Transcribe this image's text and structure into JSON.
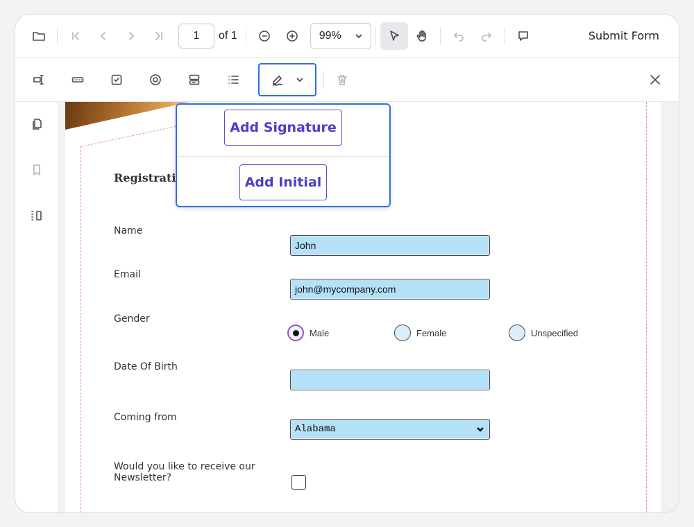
{
  "toolbar": {
    "page_number": "1",
    "page_total": "of 1",
    "zoom": "99%",
    "submit_label": "Submit Form"
  },
  "form": {
    "title": "Registration",
    "fields": {
      "name_label": "Name",
      "name_value": "John",
      "email_label": "Email",
      "email_value": "john@mycompany.com",
      "gender_label": "Gender",
      "gender_options": [
        "Male",
        "Female",
        "Unspecified"
      ],
      "dob_label": "Date Of Birth",
      "coming_from_label": "Coming from",
      "coming_from_value": "Alabama",
      "newsletter_label_1": "Would you like to receive our",
      "newsletter_label_2": "Newsletter?"
    }
  },
  "signature_popup": {
    "add_signature": "Add Signature",
    "add_initial": "Add Initial"
  },
  "colors": {
    "accent": "#2f6fe0",
    "popup_text": "#4b3fc8",
    "field_fill": "#b4e0f8",
    "dashed_border": "#e6987a"
  }
}
